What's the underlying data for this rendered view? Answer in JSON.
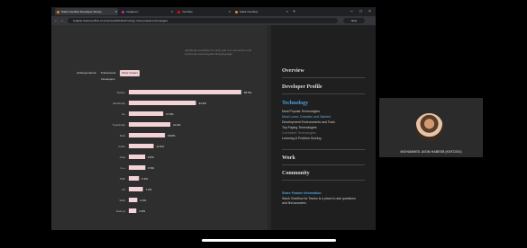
{
  "browser": {
    "tabs": [
      {
        "label": "Stack Overflow Developer Survey",
        "active": true,
        "color": "#f48024"
      },
      {
        "label": "Instagram",
        "active": false,
        "color": "#d6249f"
      },
      {
        "label": "YouTube",
        "active": false,
        "color": "#ff0000"
      },
      {
        "label": "Stack Overflow",
        "active": false,
        "color": "#f48024"
      }
    ],
    "url": "insights.stackoverflow.com/survey/2021#technology-most-popular-technologies",
    "profile_label": "New"
  },
  "survey": {
    "response_tabs": [
      "All Respondents",
      "Professional Developers",
      "Other Coders"
    ],
    "selected_tab": 2,
    "note": "JavaScript completes its ninth year in a row as the most commonly used programming language."
  },
  "chart_data": {
    "type": "bar",
    "orientation": "horizontal",
    "categories": [
      "Python",
      "JavaScript",
      "Go",
      "TypeScript",
      "Rust",
      "Kotlin",
      "Java",
      "C++",
      "PHP",
      "C#",
      "Swift",
      "Node.js"
    ],
    "values": [
      58.5,
      34.9,
      17.9,
      21.6,
      18.8,
      12.9,
      8.5,
      8.6,
      5.3,
      7.3,
      4.4,
      3.9
    ],
    "value_suffix": "%",
    "bar_color": "#f4d3d8",
    "title": "",
    "xlabel": "",
    "ylabel": "",
    "xlim": [
      0,
      60
    ]
  },
  "sidebar": {
    "sections": [
      {
        "label": "Overview",
        "active": false
      },
      {
        "label": "Developer Profile",
        "active": false
      },
      {
        "label": "Technology",
        "active": true
      },
      {
        "label": "Work",
        "active": false
      },
      {
        "label": "Community",
        "active": false
      }
    ],
    "technology_items": [
      {
        "label": "Most Popular Technologies",
        "state": "normal"
      },
      {
        "label": "Most Loved, Dreaded, and Wanted",
        "state": "highlighted"
      },
      {
        "label": "Development Environments and Tools",
        "state": "normal"
      },
      {
        "label": "Top Paying Technologies",
        "state": "normal"
      },
      {
        "label": "Correlated Technologies",
        "state": "dim"
      },
      {
        "label": "Learning & Problem Solving",
        "state": "normal"
      }
    ],
    "share_heading": "Share Feature Information",
    "share_text": "Stack Overflow for Teams is a place to ask questions and find answers."
  },
  "webcam": {
    "participant_name": "MOHAMMED JASIM HABEEB (KNTC001)"
  }
}
